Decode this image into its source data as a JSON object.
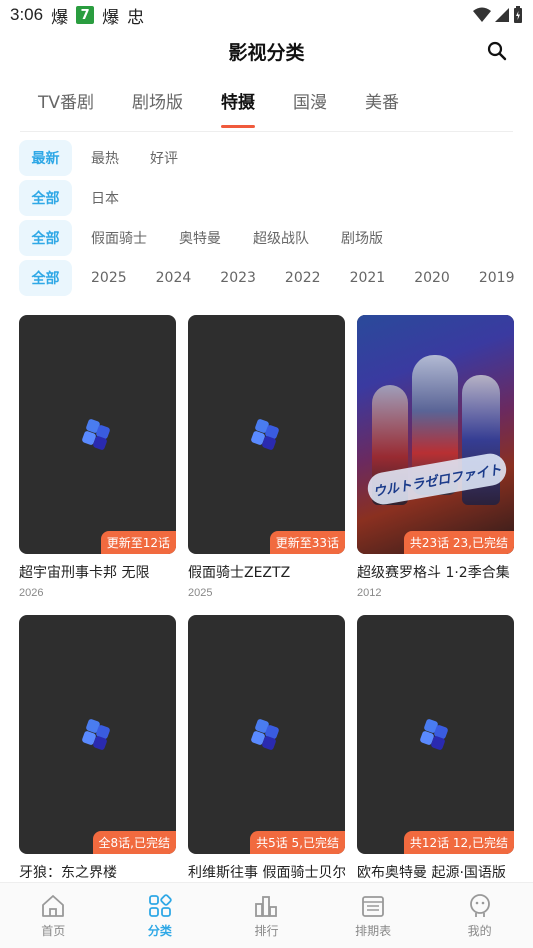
{
  "status": {
    "time": "3:06",
    "app1": "爆",
    "app2": "7",
    "app3": "爆",
    "app4": "忠"
  },
  "header": {
    "title": "影视分类"
  },
  "tabs": [
    {
      "label": "TV番剧",
      "active": false
    },
    {
      "label": "剧场版",
      "active": false
    },
    {
      "label": "特摄",
      "active": true
    },
    {
      "label": "国漫",
      "active": false
    },
    {
      "label": "美番",
      "active": false
    }
  ],
  "filters": {
    "sort": {
      "selected": "最新",
      "options": [
        "最热",
        "好评"
      ]
    },
    "region": {
      "selected": "全部",
      "options": [
        "日本"
      ]
    },
    "genre": {
      "selected": "全部",
      "options": [
        "假面骑士",
        "奥特曼",
        "超级战队",
        "剧场版"
      ]
    },
    "year": {
      "selected": "全部",
      "options": [
        "2025",
        "2024",
        "2023",
        "2022",
        "2021",
        "2020",
        "2019"
      ]
    }
  },
  "cards": [
    {
      "title": "超宇宙刑事卡邦 无限",
      "year": "2026",
      "badge": "更新至12话"
    },
    {
      "title": "假面骑士ZEZTZ",
      "year": "2025",
      "badge": "更新至33话"
    },
    {
      "title": "超级赛罗格斗 1·2季合集",
      "year": "2012",
      "badge": "共23话 23,已完结",
      "poster_text": "ウルトラゼロファイト"
    },
    {
      "title": "牙狼：东之界楼",
      "year": "",
      "badge": "全8话,已完结"
    },
    {
      "title": "利维斯往事 假面骑士贝尔",
      "year": "",
      "badge": "共5话 5,已完结"
    },
    {
      "title": "欧布奥特曼 起源·国语版",
      "year": "",
      "badge": "共12话 12,已完结"
    }
  ],
  "bottom_nav": [
    {
      "label": "首页",
      "icon": "home-icon",
      "active": false
    },
    {
      "label": "分类",
      "icon": "category-icon",
      "active": true
    },
    {
      "label": "排行",
      "icon": "ranking-icon",
      "active": false
    },
    {
      "label": "排期表",
      "icon": "schedule-icon",
      "active": false
    },
    {
      "label": "我的",
      "icon": "profile-icon",
      "active": false
    }
  ],
  "colors": {
    "accent": "#2fa8e6",
    "tab_indicator": "#f05a3c",
    "badge": "#f16a3f",
    "placeholder_bg": "#2e2e2e"
  }
}
